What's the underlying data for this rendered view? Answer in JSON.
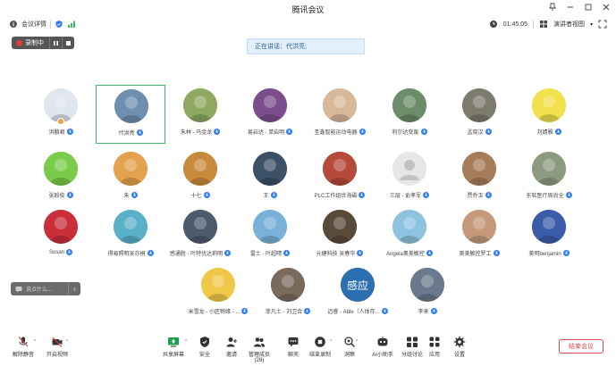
{
  "window": {
    "title": "腾讯会议"
  },
  "infobar": {
    "meeting_details": "会议详情",
    "time": "01:45:05",
    "speaker_view": "演讲者视图",
    "signal_icon": "signal-bars-icon"
  },
  "recording": {
    "label": "录制中"
  },
  "speaking": {
    "text": "正在讲话：代洪亮;"
  },
  "participants": [
    {
      "name": "洪鹏君",
      "color": "#dfe6ee",
      "host": true
    },
    {
      "name": "代洪亮",
      "color": "#6f8fb0",
      "active": true
    },
    {
      "name": "朱林 - 马金龙",
      "color": "#8faa60"
    },
    {
      "name": "易启达 - 单启明",
      "color": "#7b4d8c"
    },
    {
      "name": "圣鑫智能运动电器",
      "color": "#d8b89a"
    },
    {
      "name": "利尔达变废",
      "color": "#6c8c6a"
    },
    {
      "name": "孟晓汉",
      "color": "#7d7b6e"
    },
    {
      "name": "刘婧雅",
      "color": "#f2e04c"
    },
    {
      "name": "张毅俊",
      "color": "#7acb4a"
    },
    {
      "name": "朱",
      "color": "#e3a24d"
    },
    {
      "name": "十七",
      "color": "#c88b3c"
    },
    {
      "name": "王",
      "color": "#3c5067"
    },
    {
      "name": "PLC工作组世海磁",
      "color": "#b54a3b"
    },
    {
      "name": "三层 - 俞孝军",
      "color": "#e0e0e0"
    },
    {
      "name": "贾乔玉",
      "color": "#a67d5a"
    },
    {
      "name": "东软医疗周尚全",
      "color": "#8c9a80"
    },
    {
      "name": "Susan",
      "color": "#c92e3a"
    },
    {
      "name": "得易照明吴亦桐",
      "color": "#5bb0c9"
    },
    {
      "name": "感通胜 - 叶特优达莉明",
      "color": "#4d5a6c"
    },
    {
      "name": "雷士 - 叶超晴",
      "color": "#7ab1d8"
    },
    {
      "name": "元健科技 吴春华",
      "color": "#5a4a3a"
    },
    {
      "name": "Angela奥美敏控",
      "color": "#8ec3e0"
    },
    {
      "name": "奥美敏控罗工",
      "color": "#c49a7a"
    },
    {
      "name": "美明benjamin",
      "color": "#3b5ca8"
    },
    {
      "name": "米雪龙 - 小匠物缘 - ...",
      "color": "#f0c848"
    },
    {
      "name": "菲凡士 - 刘卫合",
      "color": "#7a6a5c"
    },
    {
      "name": "迈睿 - Able（人体存...",
      "color": "#2c6fb0",
      "text": "感应"
    },
    {
      "name": "李来",
      "color": "#6a7a8c"
    }
  ],
  "chat": {
    "placeholder": "说点什么..."
  },
  "toolbar": {
    "items": [
      {
        "label": "解除静音",
        "icon": "microphone-muted-icon"
      },
      {
        "label": "开启视频",
        "icon": "video-off-icon"
      },
      {
        "label": "共享屏幕",
        "icon": "share-screen-icon"
      },
      {
        "label": "安全",
        "icon": "shield-icon"
      },
      {
        "label": "邀请",
        "icon": "add-user-icon"
      },
      {
        "label": "管理成员(28)",
        "icon": "members-icon"
      },
      {
        "label": "聊天",
        "icon": "chat-icon"
      },
      {
        "label": "结束录制",
        "icon": "stop-record-icon"
      },
      {
        "label": "洞察",
        "icon": "insight-icon"
      },
      {
        "label": "AI小助手",
        "icon": "ai-assistant-icon"
      },
      {
        "label": "分组讨论",
        "icon": "breakout-icon"
      },
      {
        "label": "应用",
        "icon": "apps-icon"
      },
      {
        "label": "设置",
        "icon": "settings-icon"
      }
    ],
    "end_meeting": "结束会议"
  }
}
